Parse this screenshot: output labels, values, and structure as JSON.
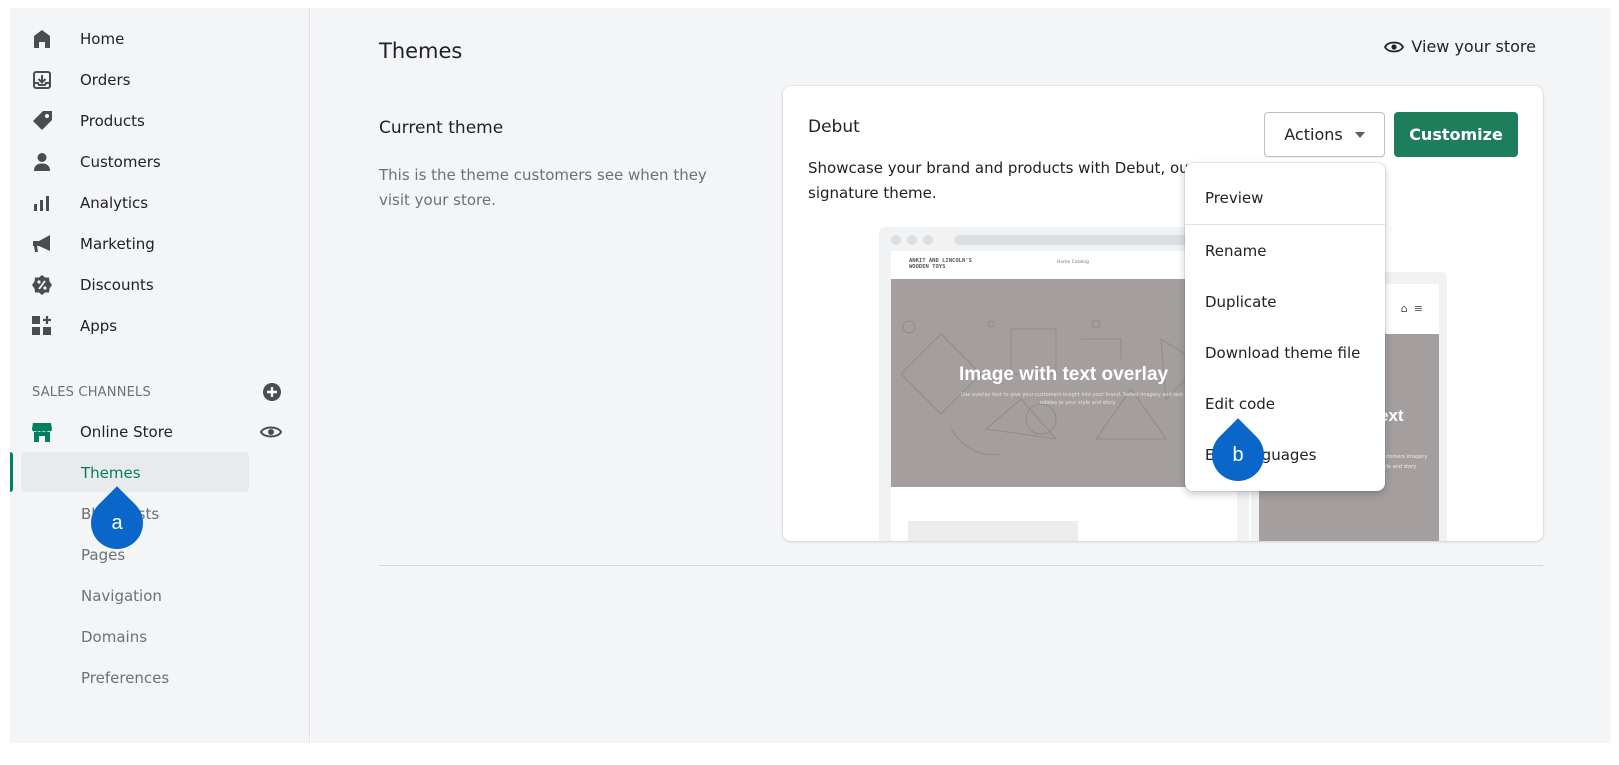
{
  "sidebar": {
    "items": [
      {
        "label": "Home",
        "icon": "home-icon"
      },
      {
        "label": "Orders",
        "icon": "orders-icon"
      },
      {
        "label": "Products",
        "icon": "tag-icon"
      },
      {
        "label": "Customers",
        "icon": "person-icon"
      },
      {
        "label": "Analytics",
        "icon": "bar-chart-icon"
      },
      {
        "label": "Marketing",
        "icon": "megaphone-icon"
      },
      {
        "label": "Discounts",
        "icon": "discount-icon"
      },
      {
        "label": "Apps",
        "icon": "apps-icon"
      }
    ],
    "sales_channels_label": "SALES CHANNELS",
    "online_store_label": "Online Store",
    "sub_items": [
      "Themes",
      "Blog posts",
      "Pages",
      "Navigation",
      "Domains",
      "Preferences"
    ],
    "active_sub_item": "Themes"
  },
  "header": {
    "title": "Themes",
    "view_store_label": "View your store"
  },
  "current_theme": {
    "section_title": "Current theme",
    "section_desc": "This is the theme customers see when they visit your store.",
    "theme_name": "Debut",
    "theme_desc": "Showcase your brand and products with Debut, our signature theme.",
    "actions_label": "Actions",
    "customize_label": "Customize"
  },
  "preview": {
    "store_name_line1": "ANKIT AND LINCOLN'S",
    "store_name_line2": "WOODEN TOYS",
    "nav_links": "Home   Catalog",
    "hero_title": "Image with text overlay",
    "hero_sub": "Use overlay text to give your customers insight into your brand. Select imagery and text that relates to your style and story.",
    "mobile_hero_title": "ext",
    "mobile_hero_sub": "customers imagery style and story"
  },
  "actions_menu": {
    "items": [
      "Preview",
      "Rename",
      "Duplicate",
      "Download theme file",
      "Edit code",
      "Edit languages"
    ]
  },
  "callouts": {
    "a": "a",
    "b": "b"
  },
  "colors": {
    "accent_green": "#1e7e5c",
    "callout_blue": "#0a66c8",
    "hero_gray": "#a49e9e"
  }
}
